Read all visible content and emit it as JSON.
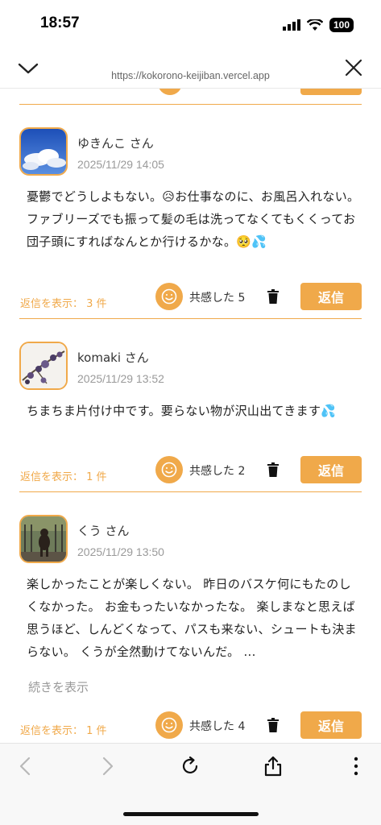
{
  "status": {
    "time": "18:57",
    "battery": "100"
  },
  "browser": {
    "url": "https://kokorono-keijiban.vercel.app"
  },
  "icons": {
    "collapse": "chevron-down-icon",
    "close": "close-icon",
    "empathy": "smiley-icon",
    "delete": "trash-icon",
    "back": "arrow-left-icon",
    "forward": "arrow-right-icon",
    "reload": "reload-icon",
    "share": "share-icon",
    "menu": "more-vertical-icon"
  },
  "colors": {
    "accent": "#f0a94a",
    "muted_text": "#9a9a9a"
  },
  "posts": [
    {
      "username": "ゆきんこ さん",
      "timestamp": "2025/11/29 14:05",
      "avatar": "blue sky with clouds",
      "body": "憂鬱でどうしよもない。😥お仕事なのに、お風呂入れない。ファブリーズでも振って髪の毛は洗ってなくてもくくってお団子頭にすればなんとか行けるかな。🥺💦",
      "reply_count": "返信を表示： 3 件",
      "empathy": "共感した 5",
      "reply_label": "返信"
    },
    {
      "username": "komaki さん",
      "timestamp": "2025/11/29 13:52",
      "avatar": "purple flower branch",
      "body": "ちまちま片付け中です。要らない物が沢山出てきます💦",
      "reply_count": "返信を表示： 1 件",
      "empathy": "共感した 2",
      "reply_label": "返信"
    },
    {
      "username": "くう さん",
      "timestamp": "2025/11/29 13:50",
      "avatar": "dog photo",
      "body": "楽しかったことが楽しくない。 昨日のバスケ何にもたのしくなかった。 お金もったいなかったな。 楽しまなと思えば思うほど、しんどくなって、パスも来ない、シュートも決まらない。 くうが全然動けてないんだ。 ...",
      "more_label": "続きを表示",
      "reply_count": "返信を表示： 1 件",
      "empathy": "共感した 4",
      "reply_label": "返信"
    }
  ]
}
